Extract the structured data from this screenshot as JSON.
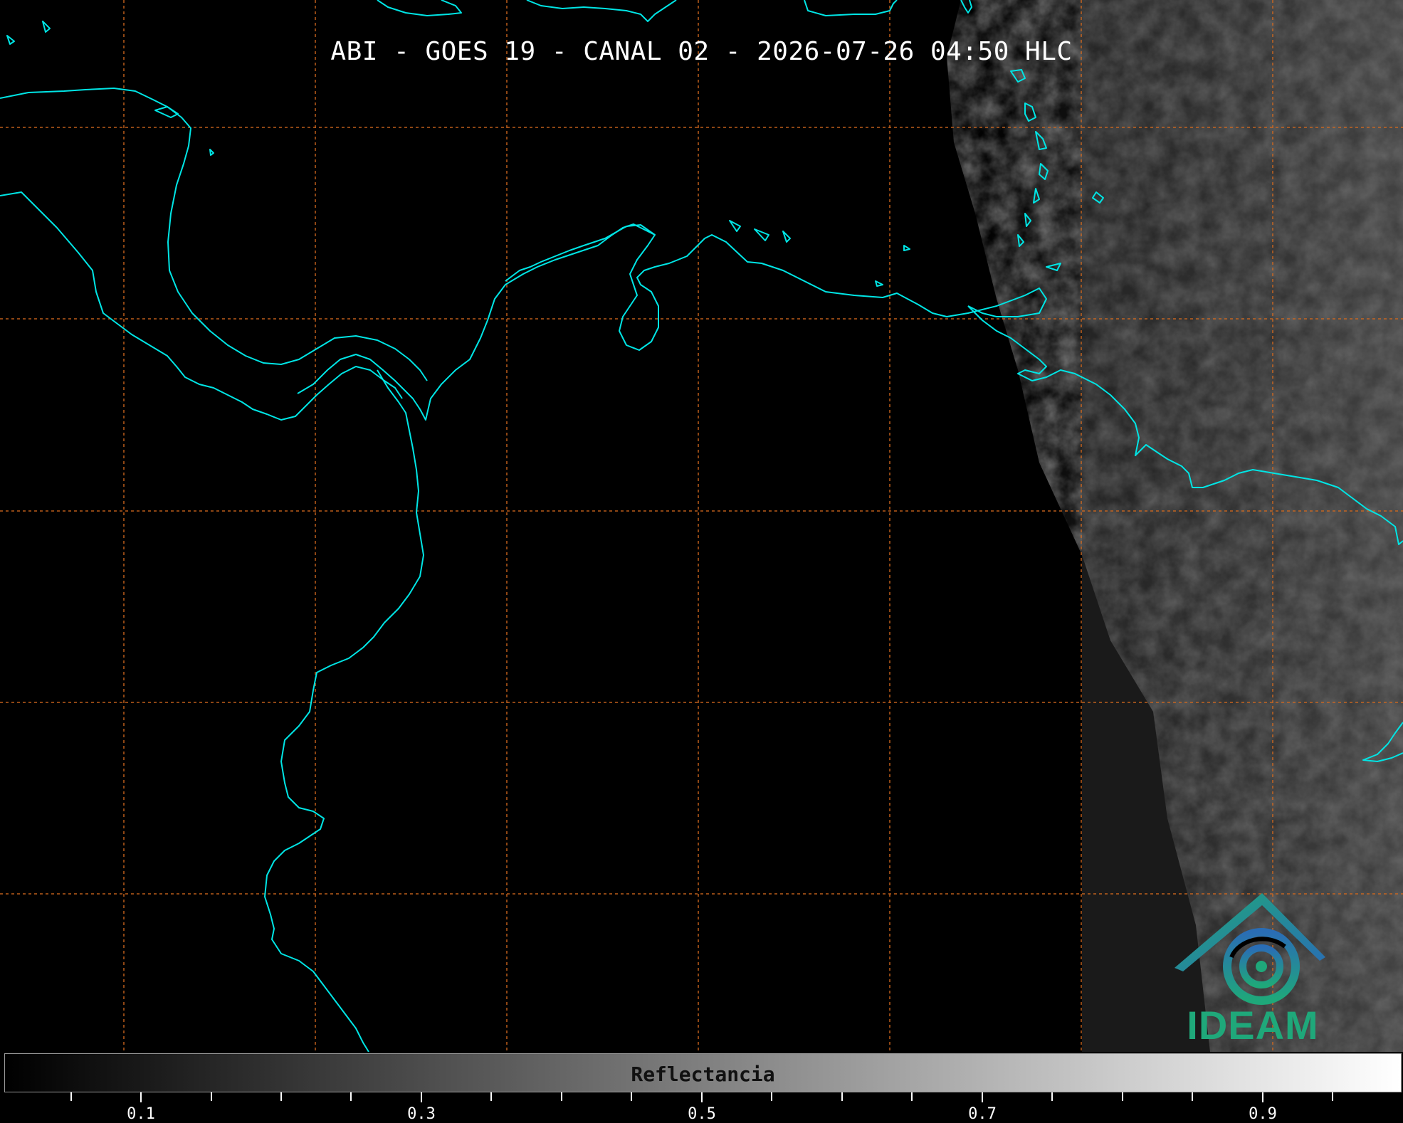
{
  "title": "ABI - GOES 19 - CANAL 02 - 2026-07-26 04:50 HLC",
  "colorbar": {
    "label": "Reflectancia",
    "tick_labels": [
      "0.1",
      "0.3",
      "0.5",
      "0.7",
      "0.9"
    ],
    "colormap": "grayscale",
    "range": [
      0.0,
      1.0
    ]
  },
  "logo": {
    "text": "IDEAM"
  },
  "colors": {
    "coastline": "#00e5e5",
    "gridlines": "#d2691e",
    "background": "#000000",
    "logo_green": "#1fa87a",
    "logo_blue": "#2a6db5"
  },
  "map": {
    "gridlines": "dashed",
    "coastlines": true,
    "cloud_region": "east"
  }
}
